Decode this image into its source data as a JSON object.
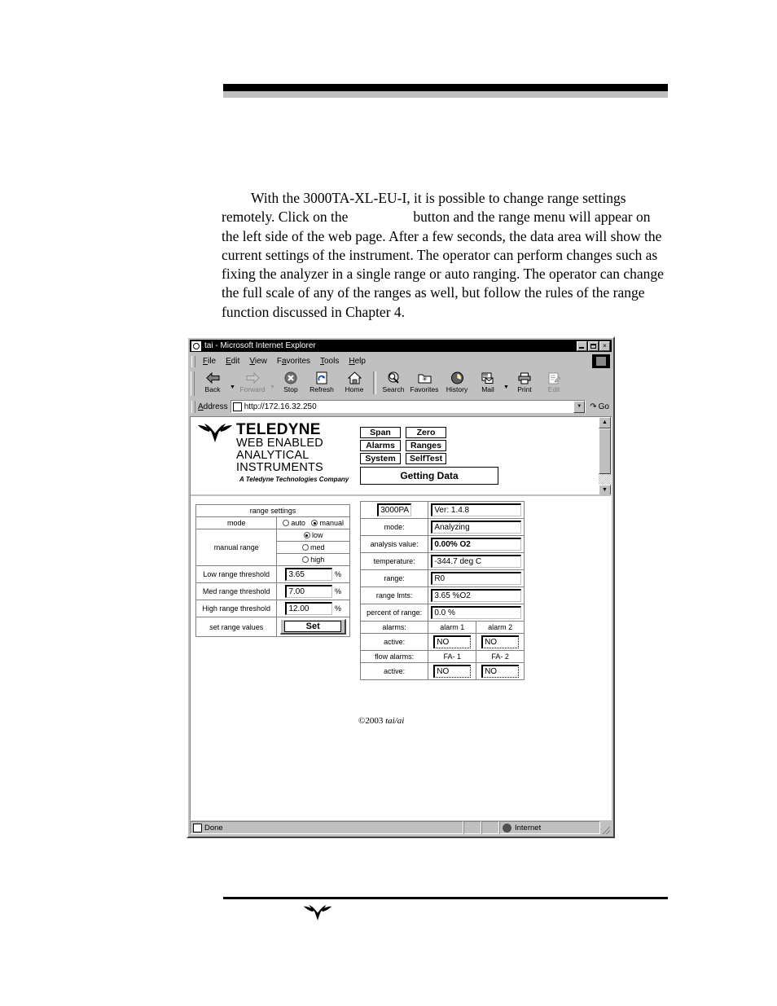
{
  "document": {
    "paragraph_lead": "With the 3000TA-XL-EU-I, it is possible to change range settings",
    "paragraph_line2a": "remotely. Click on the",
    "paragraph_line2b": "button and the range menu will appear on",
    "paragraph_rest": "the left side of the web page. After a few seconds, the data area will show the current settings of the instrument. The operator can perform changes such as fixing the analyzer in a single range or auto ranging. The operator can change the full scale of any of the ranges as well, but follow the rules of the range function discussed in Chapter 4."
  },
  "browser": {
    "title": "tai - Microsoft Internet Explorer",
    "window_buttons": {
      "minimize": "_",
      "maximize": "□",
      "close": "×"
    },
    "menu": [
      {
        "pre": "F",
        "key": "i",
        "post": "le"
      },
      {
        "pre": "",
        "key": "E",
        "post": "dit"
      },
      {
        "pre": "",
        "key": "V",
        "post": "iew"
      },
      {
        "pre": "F",
        "key": "a",
        "post": "vorites"
      },
      {
        "pre": "",
        "key": "T",
        "post": "ools"
      },
      {
        "pre": "",
        "key": "H",
        "post": "elp"
      }
    ],
    "toolbar": [
      {
        "label": "Back",
        "icon": "back-arrow-icon",
        "glyph": "⇦",
        "disabled": false,
        "dropdown": true
      },
      {
        "label": "Forward",
        "icon": "forward-arrow-icon",
        "glyph": "⇨",
        "disabled": true,
        "dropdown": true
      },
      {
        "label": "Stop",
        "icon": "stop-icon",
        "glyph": "✖",
        "disabled": false,
        "dropdown": false
      },
      {
        "label": "Refresh",
        "icon": "refresh-icon",
        "glyph": "↻",
        "disabled": false,
        "dropdown": false
      },
      {
        "label": "Home",
        "icon": "home-icon",
        "glyph": "⌂",
        "disabled": false,
        "dropdown": false
      },
      {
        "label": "Search",
        "icon": "search-icon",
        "glyph": "⌕",
        "disabled": false,
        "dropdown": false
      },
      {
        "label": "Favorites",
        "icon": "favorites-folder-icon",
        "glyph": "★",
        "disabled": false,
        "dropdown": false
      },
      {
        "label": "History",
        "icon": "history-clock-icon",
        "glyph": "◴",
        "disabled": false,
        "dropdown": false
      },
      {
        "label": "Mail",
        "icon": "mail-icon",
        "glyph": "✉",
        "disabled": false,
        "dropdown": true
      },
      {
        "label": "Print",
        "icon": "printer-icon",
        "glyph": "⎙",
        "disabled": false,
        "dropdown": false
      },
      {
        "label": "Edit",
        "icon": "edit-page-icon",
        "glyph": "✎",
        "disabled": true,
        "dropdown": false
      }
    ],
    "address": {
      "label_pre": "A",
      "label_key": "d",
      "label_post": "dress",
      "value": "http://172.16.32.250",
      "go_label": "Go",
      "go_icon": "go-arrow-icon"
    },
    "status": {
      "message": "Done",
      "zone": "Internet",
      "page_icon": "page-icon",
      "zone_icon": "globe-icon"
    }
  },
  "webpage": {
    "brand": {
      "name": "TELEDYNE",
      "line1": "WEB ENABLED",
      "line2": "ANALYTICAL",
      "line3": "INSTRUMENTS",
      "tagline": "A Teledyne Technologies Company",
      "logo_icon": "teledyne-leaf-logo"
    },
    "nav_buttons": [
      [
        "Span",
        "Zero"
      ],
      [
        "Alarms",
        "Ranges"
      ],
      [
        "System",
        "SelfTest"
      ]
    ],
    "status_button": "Getting Data",
    "range_settings": {
      "title": "range settings",
      "mode_label": "mode",
      "mode_options": [
        {
          "label": "auto",
          "selected": false
        },
        {
          "label": "manual",
          "selected": true
        }
      ],
      "manual_range_label": "manual range",
      "manual_range_options": [
        {
          "label": "low",
          "selected": true
        },
        {
          "label": "med",
          "selected": false
        },
        {
          "label": "high",
          "selected": false
        }
      ],
      "thresholds": [
        {
          "label": "Low range threshold",
          "value": "3.65",
          "unit": "%"
        },
        {
          "label": "Med range threshold",
          "value": "7.00",
          "unit": "%"
        },
        {
          "label": "High range threshold",
          "value": "12.00",
          "unit": "%"
        }
      ],
      "set_row_label": "set range values",
      "set_button": "Set"
    },
    "data_panel": {
      "model": "3000PA",
      "version": "Ver:  1.4.8",
      "rows": [
        {
          "label": "mode:",
          "value": "Analyzing",
          "bold": false
        },
        {
          "label": "analysis value:",
          "value": "0.00% O2",
          "bold": true
        },
        {
          "label": "temperature:",
          "value": "-344.7 deg C",
          "bold": false
        },
        {
          "label": "range:",
          "value": "R0",
          "bold": false
        },
        {
          "label": "range lmts:",
          "value": "3.65 %O2",
          "bold": false
        },
        {
          "label": "percent of range:",
          "value": "0.0 %",
          "bold": false
        }
      ],
      "alarms_label": "alarms:",
      "alarm_names": [
        "alarm 1",
        "alarm 2"
      ],
      "active_label": "active:",
      "alarm_active": [
        "NO",
        "NO"
      ],
      "flow_alarms_label": "flow alarms:",
      "flow_alarm_names": [
        "FA- 1",
        "FA- 2"
      ],
      "flow_active_label": "active:",
      "flow_alarm_active": [
        "NO",
        "NO"
      ]
    },
    "copyright_symbol": "©2003",
    "copyright_name": "tai/ai"
  }
}
